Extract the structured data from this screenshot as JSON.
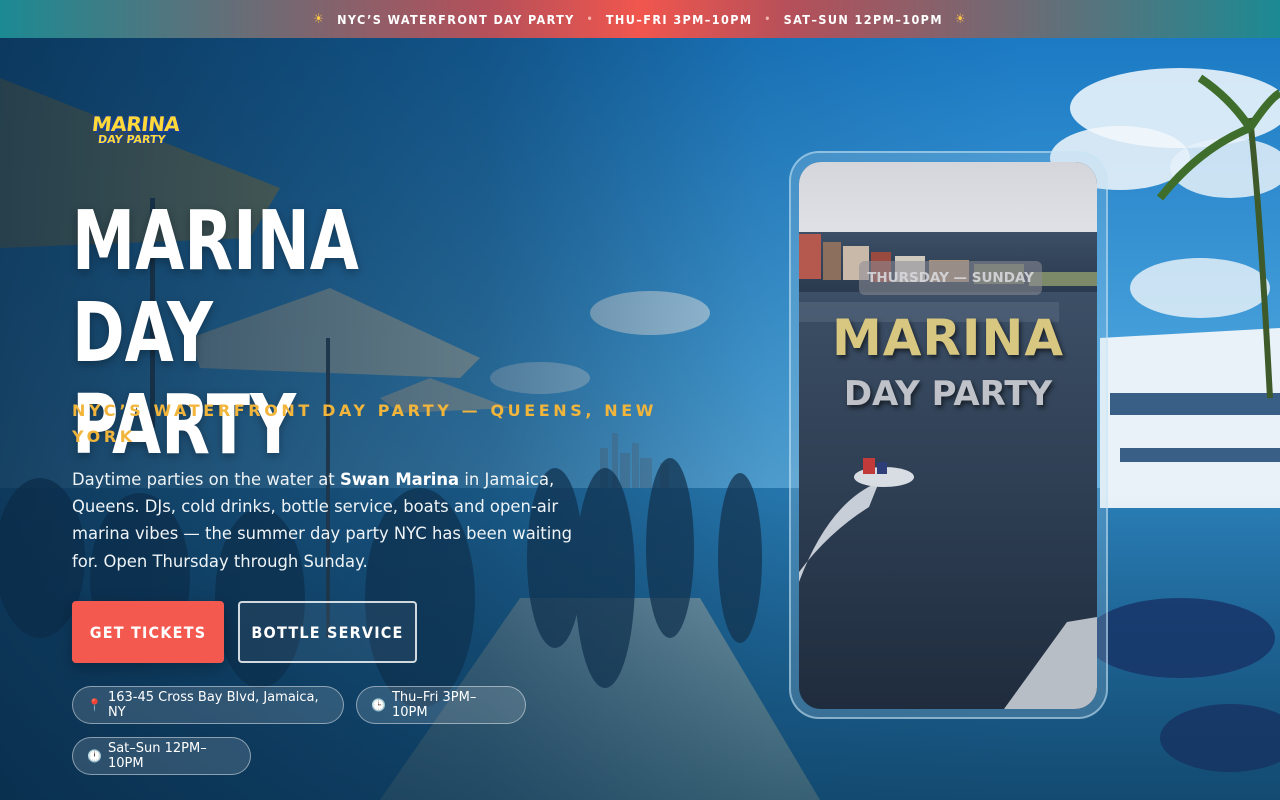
{
  "ticker": {
    "sun_icon": "☀",
    "item1": "NYC’S WATERFRONT DAY PARTY",
    "separator": "•",
    "item2": "THU–FRI 3PM–10PM",
    "item3": "SAT–SUN 12PM–10PM"
  },
  "logo": {
    "line1": "MARINA",
    "line2": "DAY PARTY"
  },
  "hero": {
    "title_line1": "MARINA DAY",
    "title_line2": "PARTY",
    "subtitle": "NYC’s Waterfront Day Party — Queens, New York",
    "desc_pre": "Daytime parties on the water at ",
    "desc_venue": "Swan Marina",
    "desc_post": " in Jamaica, Queens. DJs, cold drinks, bottle service, boats and open-air marina vibes — the summer day party NYC has been waiting for. Open Thursday through Sunday."
  },
  "buttons": {
    "tickets": "GET TICKETS",
    "bottle": "BOTTLE SERVICE"
  },
  "pills": {
    "address_icon": "📍",
    "address": "163-45 Cross Bay Blvd, Jamaica, NY",
    "weekday_icon": "🕒",
    "weekday": "Thu–Fri 3PM–10PM",
    "weekend_icon": "🕛",
    "weekend": "Sat–Sun 12PM–10PM"
  },
  "phone": {
    "overlay_days": "THURSDAY — SUNDAY",
    "overlay_title1": "MARINA",
    "overlay_title2": "DAY PARTY"
  },
  "colors": {
    "accent": "#f4594f",
    "subtitle_gold": "#f2b53c",
    "logo_yellow": "#ffd93a",
    "ticker_teal": "#1c8a93"
  }
}
